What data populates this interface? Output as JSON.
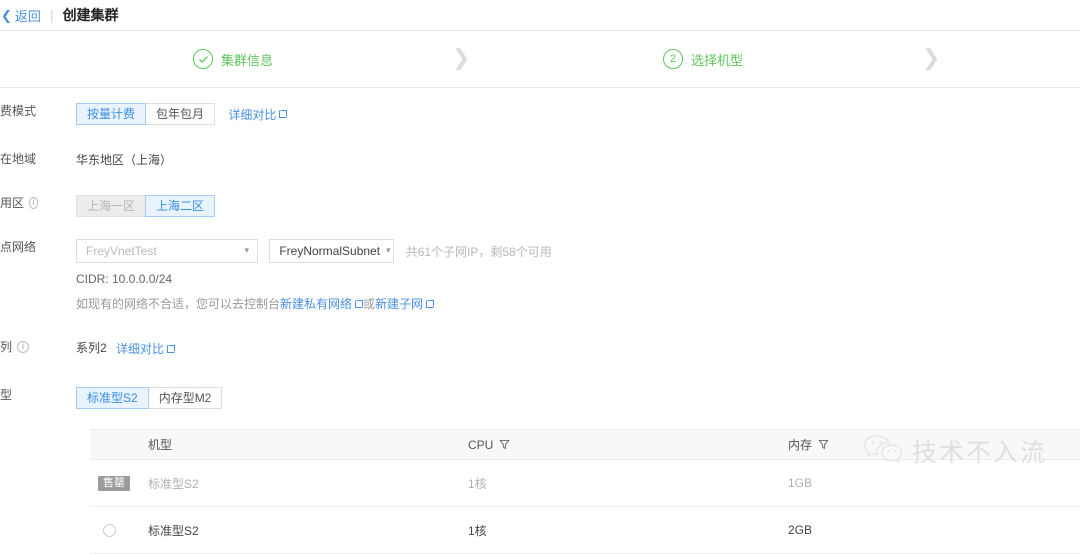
{
  "header": {
    "back_label": "返回",
    "title": "创建集群"
  },
  "steps": [
    {
      "indicator": "check",
      "label": "集群信息",
      "state": "done"
    },
    {
      "indicator": "2",
      "label": "选择机型",
      "state": "active"
    }
  ],
  "form": {
    "billing": {
      "label": "计费模式",
      "options": [
        "按量计费",
        "包年包月"
      ],
      "selected": "按量计费",
      "compare_link": "详细对比"
    },
    "region": {
      "label": "所在地域",
      "value": "华东地区（上海）"
    },
    "zone": {
      "label": "可用区",
      "options": [
        "上海一区",
        "上海二区"
      ],
      "disabled": [
        "上海一区"
      ],
      "selected": "上海二区"
    },
    "network": {
      "label": "节点网络",
      "vpc_value": "FreyVnetTest",
      "subnet_value": "FreyNormalSubnet",
      "subnet_hint": "共61个子网IP，剩58个可用",
      "cidr": "CIDR: 10.0.0.0/24",
      "note_prefix": "如现有的网络不合适，您可以去控制台",
      "note_link_1": "新建私有网络",
      "note_middle": "或",
      "note_link_2": "新建子网"
    },
    "series": {
      "label": "系列",
      "value": "系列2",
      "compare_link": "详细对比"
    },
    "model": {
      "label": "机型",
      "options": [
        "标准型S2",
        "内存型M2"
      ],
      "selected": "标准型S2"
    }
  },
  "table": {
    "columns": [
      "机型",
      "CPU",
      "内存"
    ],
    "rows": [
      {
        "badge": "售罄",
        "selectable": false,
        "model": "标准型S2",
        "cpu": "1核",
        "memory": "1GB"
      },
      {
        "badge": "",
        "selectable": true,
        "model": "标准型S2",
        "cpu": "1核",
        "memory": "2GB"
      }
    ]
  },
  "watermark": {
    "text": "技术不入流"
  },
  "colors": {
    "accent_blue": "#4a90e2",
    "step_green": "#5ec75e",
    "selected_bg": "#e9f3fd",
    "badge_gray": "#9b9b9b"
  }
}
